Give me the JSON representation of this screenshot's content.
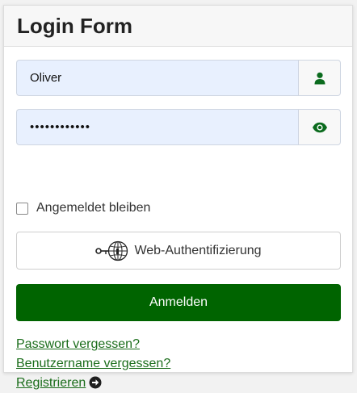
{
  "form": {
    "title": "Login Form",
    "username": {
      "value": "Oliver",
      "icon": "user-icon"
    },
    "password": {
      "value": "••••••••••••",
      "icon": "eye-icon"
    },
    "remember_label": "Angemeldet bleiben",
    "remember_checked": false,
    "webauthn_label": "Web-Authentifizierung",
    "webauthn_icon": "key-globe-icon",
    "submit_label": "Anmelden",
    "links": [
      {
        "label": "Passwort vergessen?"
      },
      {
        "label": "Benutzername vergessen?"
      },
      {
        "label": "Registrieren",
        "icon": "arrow-circle-right-icon"
      }
    ],
    "accent_color": "#006400",
    "link_color": "#1b6d1b",
    "field_background": "#e8f0fe"
  }
}
